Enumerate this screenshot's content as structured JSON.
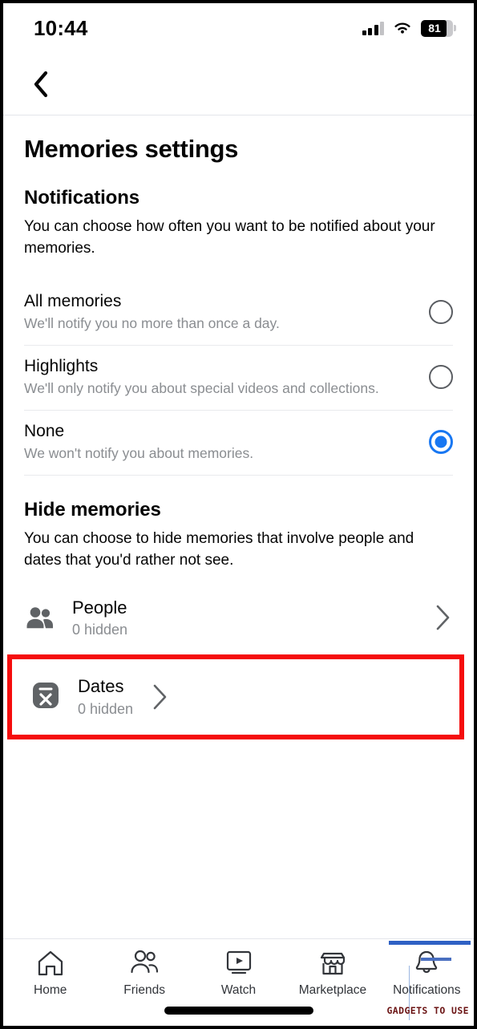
{
  "status_bar": {
    "time": "10:44",
    "battery_percent": "81",
    "signal_icon": "signal-bars-icon",
    "wifi_icon": "wifi-icon",
    "battery_icon": "battery-icon"
  },
  "nav": {
    "back_icon": "chevron-left-icon"
  },
  "page": {
    "title": "Memories settings"
  },
  "notifications": {
    "heading": "Notifications",
    "description": "You can choose how often you want to be notified about your memories.",
    "options": [
      {
        "label": "All memories",
        "sub": "We'll notify you no more than once a day.",
        "selected": false
      },
      {
        "label": "Highlights",
        "sub": "We'll only notify you about special videos and collections.",
        "selected": false
      },
      {
        "label": "None",
        "sub": "We won't notify you about memories.",
        "selected": true
      }
    ]
  },
  "hide_memories": {
    "heading": "Hide memories",
    "description": "You can choose to hide memories that involve people and dates that you'd rather not see.",
    "rows": [
      {
        "label": "People",
        "sub": "0 hidden",
        "icon": "people-icon",
        "chevron": "chevron-right-icon",
        "highlighted": false
      },
      {
        "label": "Dates",
        "sub": "0 hidden",
        "icon": "calendar-x-icon",
        "chevron": "chevron-right-icon",
        "highlighted": true
      }
    ]
  },
  "tabbar": {
    "tabs": [
      {
        "label": "Home",
        "icon": "home-icon"
      },
      {
        "label": "Friends",
        "icon": "friends-icon"
      },
      {
        "label": "Watch",
        "icon": "watch-video-icon"
      },
      {
        "label": "Marketplace",
        "icon": "marketplace-store-icon"
      },
      {
        "label": "Notifications",
        "icon": "bell-icon"
      }
    ]
  },
  "watermark": {
    "text": "GADGETS TO USE"
  },
  "colors": {
    "accent_blue": "#1877f2",
    "highlight_red": "#f50d0d",
    "muted_text": "#8a8d91",
    "primary_text": "#050505"
  }
}
